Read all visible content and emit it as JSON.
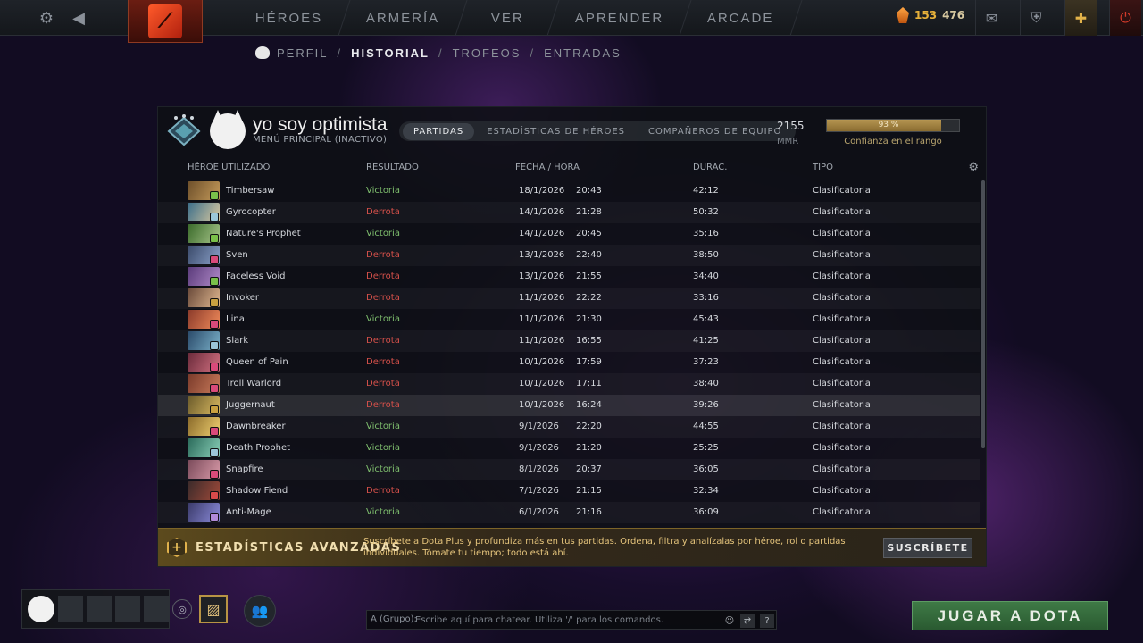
{
  "topbar": {
    "nav": [
      "HÉROES",
      "ARMERÍA",
      "VER",
      "APRENDER",
      "ARCADE"
    ],
    "currency": {
      "shards": "153",
      "second": "476"
    },
    "colors": {
      "accent": "#e7b13a",
      "plus": "#e2b24a",
      "power": "#d33a2a"
    }
  },
  "subnav": {
    "items": [
      "PERFIL",
      "HISTORIAL",
      "TROFEOS",
      "ENTRADAS"
    ],
    "separator": "/"
  },
  "profile": {
    "name": "yo soy optimista",
    "status": "MENÚ PRINCIPAL (INACTIVO)",
    "mmr": "2155",
    "mmr_label": "MMR",
    "confidence": 0.93,
    "confidence_text": "93 %",
    "confidence_label": "Confianza en el rango"
  },
  "tabs": [
    "PARTIDAS",
    "ESTADÍSTICAS DE HÉROES",
    "COMPAÑEROS DE EQUIPO"
  ],
  "table": {
    "headers": {
      "hero": "HÉROE UTILIZADO",
      "result": "RESULTADO",
      "datetime": "FECHA / HORA",
      "duration": "DURAC.",
      "type": "TIPO"
    },
    "rows": [
      {
        "hero": "Timbersaw",
        "result": "Victoria",
        "date": "18/1/2026",
        "time": "20:43",
        "duration": "42:12",
        "type": "Clasificatoria",
        "c1": "#6d4f2a",
        "c2": "#c49a5a",
        "badge": "#7ac04a"
      },
      {
        "hero": "Gyrocopter",
        "result": "Derrota",
        "date": "14/1/2026",
        "time": "21:28",
        "duration": "50:32",
        "type": "Clasificatoria",
        "c1": "#3b6e8a",
        "c2": "#d9c9a0",
        "badge": "#9bc7d9"
      },
      {
        "hero": "Nature's Prophet",
        "result": "Victoria",
        "date": "14/1/2026",
        "time": "20:45",
        "duration": "35:16",
        "type": "Clasificatoria",
        "c1": "#3a6a2a",
        "c2": "#a7c58a",
        "badge": "#7ac04a"
      },
      {
        "hero": "Sven",
        "result": "Derrota",
        "date": "13/1/2026",
        "time": "22:40",
        "duration": "38:50",
        "type": "Clasificatoria",
        "c1": "#3a4a6a",
        "c2": "#8aa0c8",
        "badge": "#d94a7a"
      },
      {
        "hero": "Faceless Void",
        "result": "Derrota",
        "date": "13/1/2026",
        "time": "21:55",
        "duration": "34:40",
        "type": "Clasificatoria",
        "c1": "#5a3a7a",
        "c2": "#b08ac8",
        "badge": "#7ac04a"
      },
      {
        "hero": "Invoker",
        "result": "Derrota",
        "date": "11/1/2026",
        "time": "22:22",
        "duration": "33:16",
        "type": "Clasificatoria",
        "c1": "#6a4a3a",
        "c2": "#e0b890",
        "badge": "#c8a040"
      },
      {
        "hero": "Lina",
        "result": "Victoria",
        "date": "11/1/2026",
        "time": "21:30",
        "duration": "45:43",
        "type": "Clasificatoria",
        "c1": "#8a3a2a",
        "c2": "#f08a5a",
        "badge": "#d94a7a"
      },
      {
        "hero": "Slark",
        "result": "Derrota",
        "date": "11/1/2026",
        "time": "16:55",
        "duration": "41:25",
        "type": "Clasificatoria",
        "c1": "#2a4a6a",
        "c2": "#7ab0c8",
        "badge": "#9bc7d9"
      },
      {
        "hero": "Queen of Pain",
        "result": "Derrota",
        "date": "10/1/2026",
        "time": "17:59",
        "duration": "37:23",
        "type": "Clasificatoria",
        "c1": "#6a2a3a",
        "c2": "#d07080",
        "badge": "#d94a7a"
      },
      {
        "hero": "Troll Warlord",
        "result": "Derrota",
        "date": "10/1/2026",
        "time": "17:11",
        "duration": "38:40",
        "type": "Clasificatoria",
        "c1": "#7a3a2a",
        "c2": "#c87a5a",
        "badge": "#d94a7a"
      },
      {
        "hero": "Juggernaut",
        "result": "Derrota",
        "date": "10/1/2026",
        "time": "16:24",
        "duration": "39:26",
        "type": "Clasificatoria",
        "c1": "#6a5a2a",
        "c2": "#d8b860",
        "badge": "#c8a040",
        "highlight": true
      },
      {
        "hero": "Dawnbreaker",
        "result": "Victoria",
        "date": "9/1/2026",
        "time": "22:20",
        "duration": "44:55",
        "type": "Clasificatoria",
        "c1": "#8a6a2a",
        "c2": "#f0d070",
        "badge": "#d94a7a"
      },
      {
        "hero": "Death Prophet",
        "result": "Victoria",
        "date": "9/1/2026",
        "time": "21:20",
        "duration": "25:25",
        "type": "Clasificatoria",
        "c1": "#2a6a5a",
        "c2": "#8ad0b8",
        "badge": "#9bc7d9"
      },
      {
        "hero": "Snapfire",
        "result": "Victoria",
        "date": "8/1/2026",
        "time": "20:37",
        "duration": "36:05",
        "type": "Clasificatoria",
        "c1": "#7a4a5a",
        "c2": "#d89aa8",
        "badge": "#d94a7a"
      },
      {
        "hero": "Shadow Fiend",
        "result": "Derrota",
        "date": "7/1/2026",
        "time": "21:15",
        "duration": "32:34",
        "type": "Clasificatoria",
        "c1": "#3a2a2a",
        "c2": "#a04a3a",
        "badge": "#d94a4a"
      },
      {
        "hero": "Anti-Mage",
        "result": "Victoria",
        "date": "6/1/2026",
        "time": "21:16",
        "duration": "36:09",
        "type": "Clasificatoria",
        "c1": "#3a3a6a",
        "c2": "#8a8ad8",
        "badge": "#b08ad8"
      }
    ]
  },
  "banner": {
    "title": "ESTADÍSTICAS AVANZADAS",
    "text": "Suscríbete a Dota Plus y profundiza más en tus partidas. Ordena, filtra y analízalas por héroe, rol o partidas individuales. Tómate tu tiempo; todo está ahí.",
    "button": "SUSCRÍBETE"
  },
  "chat": {
    "label": "A (Grupo):",
    "placeholder": "Escribe aquí para chatear. Utiliza '/' para los comandos.",
    "help": "?"
  },
  "play_button": "JUGAR A DOTA"
}
